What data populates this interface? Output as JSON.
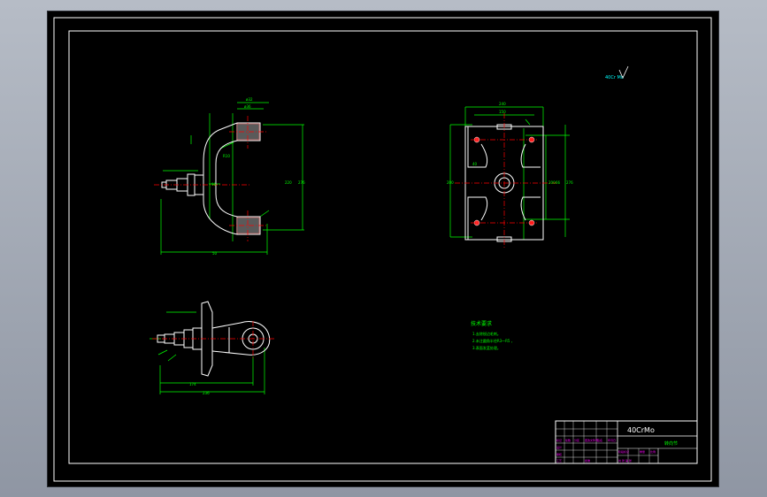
{
  "surface_note": "40Cr Mo",
  "title_block": {
    "material": "40CrMo",
    "part_name": "转向节",
    "rows": [
      "标记",
      "处数",
      "分区",
      "更改文件号",
      "签名",
      "年月日"
    ],
    "design_label": "设计",
    "review_label": "审核",
    "process_label": "工艺",
    "approve_label": "批准",
    "stage_label": "阶段标记",
    "weight_label": "重量",
    "scale_label": "比例",
    "sheet_label": "共 张 第 张"
  },
  "tech_req": {
    "title": "技术要求",
    "lines": [
      "1.去除锐边毛刺。",
      "2.未注圆角半径R3～R5 ，",
      "3.表面发蓝处理。"
    ]
  },
  "dims": {
    "top_view": [
      "ø32",
      "ø36",
      "R10",
      "96",
      "220",
      "276",
      "50"
    ],
    "right_view": [
      "240",
      "150",
      "200",
      "40",
      "200",
      "66",
      "276"
    ],
    "bottom_view": [
      "174",
      "236"
    ]
  },
  "colors": {
    "background": "#000000",
    "frame": "#ffffff",
    "geometry": "#ffffff",
    "dimension": "#00ff00",
    "center": "#ff0000",
    "annotation": "#00ffff",
    "title_block_magenta": "#ff00ff",
    "hatch": "#ff6a6a"
  }
}
